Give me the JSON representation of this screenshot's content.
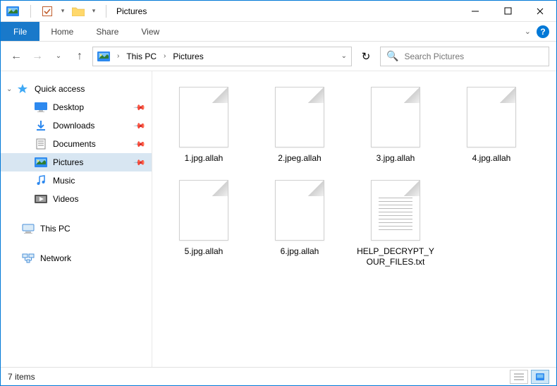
{
  "titlebar": {
    "title": "Pictures"
  },
  "ribbon": {
    "file_label": "File",
    "tabs": [
      "Home",
      "Share",
      "View"
    ]
  },
  "breadcrumb": {
    "root_arrow": "›",
    "items": [
      "This PC",
      "Pictures"
    ]
  },
  "search": {
    "placeholder": "Search Pictures"
  },
  "sidebar": {
    "quick_access": "Quick access",
    "quick_items": [
      {
        "label": "Desktop",
        "icon": "desktop",
        "pinned": true
      },
      {
        "label": "Downloads",
        "icon": "downloads",
        "pinned": true
      },
      {
        "label": "Documents",
        "icon": "documents",
        "pinned": true
      },
      {
        "label": "Pictures",
        "icon": "pictures",
        "pinned": true,
        "selected": true
      },
      {
        "label": "Music",
        "icon": "music",
        "pinned": false
      },
      {
        "label": "Videos",
        "icon": "videos",
        "pinned": false
      }
    ],
    "this_pc": "This PC",
    "network": "Network"
  },
  "files": [
    {
      "name": "1.jpg.allah",
      "type": "blank"
    },
    {
      "name": "2.jpeg.allah",
      "type": "blank"
    },
    {
      "name": "3.jpg.allah",
      "type": "blank"
    },
    {
      "name": "4.jpg.allah",
      "type": "blank"
    },
    {
      "name": "5.jpg.allah",
      "type": "blank"
    },
    {
      "name": "6.jpg.allah",
      "type": "blank"
    },
    {
      "name": "HELP_DECRYPT_YOUR_FILES.txt",
      "type": "text"
    }
  ],
  "status": {
    "count_text": "7 items"
  }
}
